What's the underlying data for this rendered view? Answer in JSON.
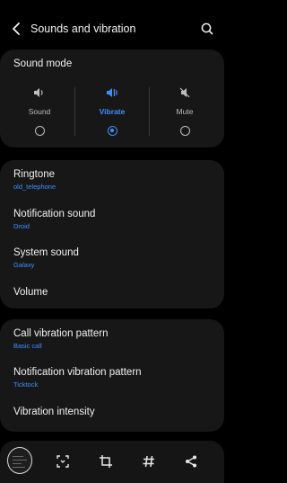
{
  "header": {
    "title": "Sounds and vibration",
    "icons": [
      "back-arrow-icon",
      "search-icon"
    ]
  },
  "sound_mode": {
    "title": "Sound mode",
    "options": [
      {
        "label": "Sound",
        "icon": "speaker-icon",
        "selected": false
      },
      {
        "label": "Vibrate",
        "icon": "vibrate-icon",
        "selected": true
      },
      {
        "label": "Mute",
        "icon": "mute-icon",
        "selected": false
      }
    ]
  },
  "sound_settings": [
    {
      "title": "Ringtone",
      "value": "old_telephone"
    },
    {
      "title": "Notification sound",
      "value": "Droid"
    },
    {
      "title": "System sound",
      "value": "Galaxy"
    },
    {
      "title": "Volume"
    }
  ],
  "vibration_settings": [
    {
      "title": "Call vibration pattern",
      "value": "Basic call"
    },
    {
      "title": "Notification vibration pattern",
      "value": "Ticktock"
    },
    {
      "title": "Vibration intensity"
    }
  ],
  "toolbar": {
    "icons": [
      "screenshot-thumbnail",
      "scroll-capture-icon",
      "crop-icon",
      "tag-icon",
      "share-icon"
    ]
  },
  "colors": {
    "background": "#000000",
    "card": "#171717",
    "accent": "#3e91ff"
  }
}
